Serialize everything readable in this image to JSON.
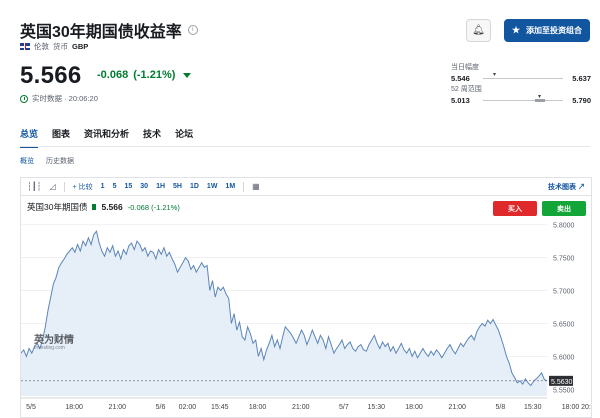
{
  "header": {
    "title": "英国30年期国债收益率",
    "exchange": "伦敦",
    "currency_label": "货币",
    "currency": "GBP",
    "realtime": "实时数据 · 20:06:20"
  },
  "quote": {
    "price": "5.566",
    "change": "-0.068",
    "change_pct": "(-1.21%)"
  },
  "buttons": {
    "watchlist": "添加至投资组合"
  },
  "ranges": {
    "day_label": "当日幅度",
    "day_low": "5.546",
    "day_high": "5.637",
    "week52_label": "52 周范围",
    "week52_low": "5.013",
    "week52_high": "5.790"
  },
  "tabs": [
    "总览",
    "图表",
    "资讯和分析",
    "技术",
    "论坛"
  ],
  "subtabs": [
    "概览",
    "历史数据"
  ],
  "toolbar": {
    "compare": "比较",
    "timeframes": [
      "1",
      "5",
      "15",
      "30",
      "1H",
      "5H",
      "1D",
      "1W",
      "1M"
    ],
    "tech_chart": "技术图表"
  },
  "chart_header": {
    "name": "英国30年期国债",
    "value": "5.566",
    "change": "-0.068 (-1.21%)",
    "buy": "买入",
    "sell": "卖出"
  },
  "watermark": {
    "main": "英为财情",
    "sub": "Investing.com"
  },
  "colors": {
    "accent": "#1256a0",
    "up_green": "#007c32",
    "buy_red": "#e0292b",
    "sell_green": "#13a538",
    "line": "#5b85b8",
    "area": "#e6eef7"
  },
  "chart_data": {
    "type": "area",
    "ylim": [
      5.54,
      5.81
    ],
    "yticks": [
      "5.8000",
      "5.7500",
      "5.7000",
      "5.6500",
      "5.6000",
      "5.5500"
    ],
    "ytick_values": [
      5.8,
      5.75,
      5.7,
      5.65,
      5.6,
      5.55
    ],
    "last_price_label": "5.5630",
    "last_price": 5.563,
    "xticks": [
      "5/5",
      "18:00",
      "21:00",
      "5/6",
      "02:00",
      "15:45",
      "18:00",
      "21:00",
      "5/7",
      "15:30",
      "18:00",
      "21:00",
      "5/8",
      "15:30",
      "18:00",
      "20:"
    ],
    "xtick_index": [
      0,
      16,
      32,
      48,
      58,
      70,
      84,
      100,
      116,
      128,
      142,
      158,
      174,
      186,
      200,
      214
    ],
    "values": [
      5.605,
      5.61,
      5.6,
      5.612,
      5.605,
      5.615,
      5.62,
      5.612,
      5.625,
      5.645,
      5.67,
      5.69,
      5.71,
      5.72,
      5.735,
      5.742,
      5.748,
      5.755,
      5.76,
      5.765,
      5.758,
      5.77,
      5.76,
      5.775,
      5.768,
      5.78,
      5.77,
      5.785,
      5.79,
      5.772,
      5.76,
      5.752,
      5.765,
      5.758,
      5.768,
      5.752,
      5.76,
      5.748,
      5.762,
      5.755,
      5.768,
      5.772,
      5.762,
      5.775,
      5.77,
      5.76,
      5.765,
      5.752,
      5.76,
      5.758,
      5.748,
      5.762,
      5.755,
      5.765,
      5.752,
      5.758,
      5.748,
      5.74,
      5.728,
      5.735,
      5.742,
      5.75,
      5.745,
      5.732,
      5.738,
      5.728,
      5.735,
      5.742,
      5.735,
      5.738,
      5.7,
      5.715,
      5.69,
      5.705,
      5.7,
      5.705,
      5.695,
      5.688,
      5.65,
      5.665,
      5.64,
      5.652,
      5.63,
      5.625,
      5.645,
      5.635,
      5.62,
      5.625,
      5.6,
      5.612,
      5.595,
      5.61,
      5.62,
      5.632,
      5.615,
      5.625,
      5.612,
      5.63,
      5.645,
      5.64,
      5.635,
      5.628,
      5.62,
      5.63,
      5.64,
      5.632,
      5.618,
      5.628,
      5.64,
      5.63,
      5.62,
      5.632,
      5.625,
      5.612,
      5.63,
      5.618,
      5.605,
      5.612,
      5.618,
      5.625,
      5.612,
      5.618,
      5.622,
      5.612,
      5.608,
      5.615,
      5.618,
      5.61,
      5.608,
      5.618,
      5.625,
      5.632,
      5.62,
      5.612,
      5.622,
      5.615,
      5.62,
      5.608,
      5.615,
      5.605,
      5.612,
      5.62,
      5.61,
      5.605,
      5.612,
      5.6,
      5.608,
      5.598,
      5.605,
      5.612,
      5.605,
      5.6,
      5.608,
      5.602,
      5.61,
      5.605,
      5.598,
      5.605,
      5.612,
      5.618,
      5.61,
      5.604,
      5.612,
      5.62,
      5.615,
      5.622,
      5.628,
      5.632,
      5.625,
      5.638,
      5.645,
      5.65,
      5.646,
      5.655,
      5.65,
      5.656,
      5.648,
      5.64,
      5.628,
      5.615,
      5.6,
      5.59,
      5.575,
      5.568,
      5.56,
      5.563,
      5.558,
      5.566,
      5.56,
      5.556,
      5.562,
      5.566,
      5.57,
      5.575,
      5.565,
      5.563
    ]
  }
}
